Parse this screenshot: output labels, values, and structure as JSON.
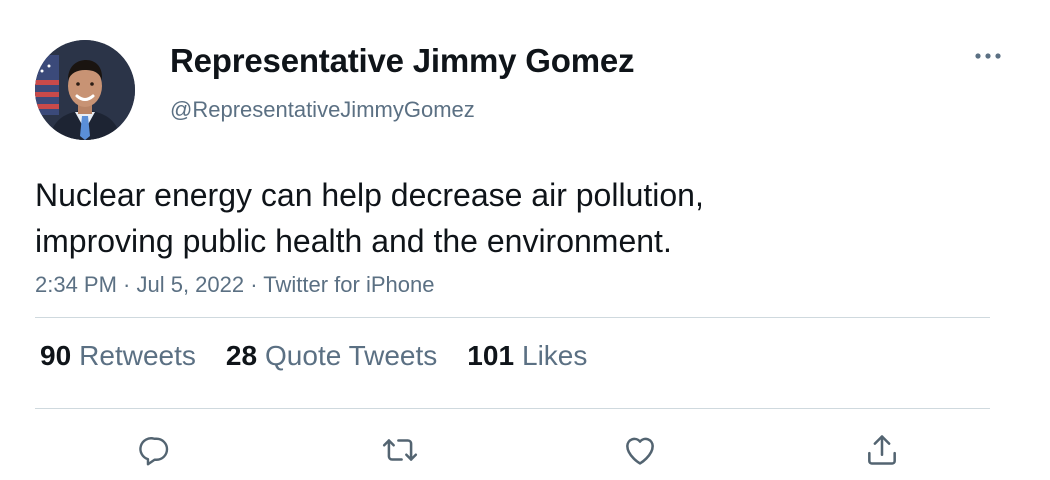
{
  "author": {
    "display_name": "Representative Jimmy Gomez",
    "handle": "@RepresentativeJimmyGomez"
  },
  "tweet": {
    "text_lines": [
      "Nuclear energy can help decrease air pollution,",
      "improving public health and the environment."
    ],
    "meta": "2:34 PM · Jul 5, 2022 · Twitter for iPhone"
  },
  "stats": [
    {
      "count": "90",
      "label": "Retweets"
    },
    {
      "count": "28",
      "label": "Quote Tweets"
    },
    {
      "count": "101",
      "label": "Likes"
    }
  ],
  "actions": [
    "reply-icon",
    "retweet-icon",
    "like-icon",
    "share-icon"
  ],
  "colors": {
    "text_primary": "#0f1419",
    "text_secondary": "#5b7083",
    "divider": "#cfd9de",
    "icon": "#536471"
  }
}
